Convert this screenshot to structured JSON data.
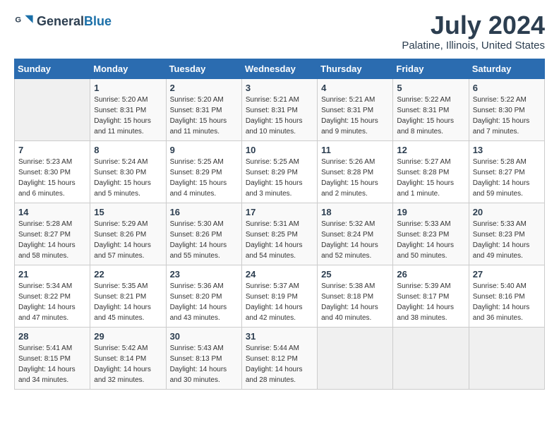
{
  "header": {
    "logo_general": "General",
    "logo_blue": "Blue",
    "title": "July 2024",
    "subtitle": "Palatine, Illinois, United States"
  },
  "calendar": {
    "days_of_week": [
      "Sunday",
      "Monday",
      "Tuesday",
      "Wednesday",
      "Thursday",
      "Friday",
      "Saturday"
    ],
    "weeks": [
      [
        {
          "day": "",
          "info": ""
        },
        {
          "day": "1",
          "info": "Sunrise: 5:20 AM\nSunset: 8:31 PM\nDaylight: 15 hours\nand 11 minutes."
        },
        {
          "day": "2",
          "info": "Sunrise: 5:20 AM\nSunset: 8:31 PM\nDaylight: 15 hours\nand 11 minutes."
        },
        {
          "day": "3",
          "info": "Sunrise: 5:21 AM\nSunset: 8:31 PM\nDaylight: 15 hours\nand 10 minutes."
        },
        {
          "day": "4",
          "info": "Sunrise: 5:21 AM\nSunset: 8:31 PM\nDaylight: 15 hours\nand 9 minutes."
        },
        {
          "day": "5",
          "info": "Sunrise: 5:22 AM\nSunset: 8:31 PM\nDaylight: 15 hours\nand 8 minutes."
        },
        {
          "day": "6",
          "info": "Sunrise: 5:22 AM\nSunset: 8:30 PM\nDaylight: 15 hours\nand 7 minutes."
        }
      ],
      [
        {
          "day": "7",
          "info": "Sunrise: 5:23 AM\nSunset: 8:30 PM\nDaylight: 15 hours\nand 6 minutes."
        },
        {
          "day": "8",
          "info": "Sunrise: 5:24 AM\nSunset: 8:30 PM\nDaylight: 15 hours\nand 5 minutes."
        },
        {
          "day": "9",
          "info": "Sunrise: 5:25 AM\nSunset: 8:29 PM\nDaylight: 15 hours\nand 4 minutes."
        },
        {
          "day": "10",
          "info": "Sunrise: 5:25 AM\nSunset: 8:29 PM\nDaylight: 15 hours\nand 3 minutes."
        },
        {
          "day": "11",
          "info": "Sunrise: 5:26 AM\nSunset: 8:28 PM\nDaylight: 15 hours\nand 2 minutes."
        },
        {
          "day": "12",
          "info": "Sunrise: 5:27 AM\nSunset: 8:28 PM\nDaylight: 15 hours\nand 1 minute."
        },
        {
          "day": "13",
          "info": "Sunrise: 5:28 AM\nSunset: 8:27 PM\nDaylight: 14 hours\nand 59 minutes."
        }
      ],
      [
        {
          "day": "14",
          "info": "Sunrise: 5:28 AM\nSunset: 8:27 PM\nDaylight: 14 hours\nand 58 minutes."
        },
        {
          "day": "15",
          "info": "Sunrise: 5:29 AM\nSunset: 8:26 PM\nDaylight: 14 hours\nand 57 minutes."
        },
        {
          "day": "16",
          "info": "Sunrise: 5:30 AM\nSunset: 8:26 PM\nDaylight: 14 hours\nand 55 minutes."
        },
        {
          "day": "17",
          "info": "Sunrise: 5:31 AM\nSunset: 8:25 PM\nDaylight: 14 hours\nand 54 minutes."
        },
        {
          "day": "18",
          "info": "Sunrise: 5:32 AM\nSunset: 8:24 PM\nDaylight: 14 hours\nand 52 minutes."
        },
        {
          "day": "19",
          "info": "Sunrise: 5:33 AM\nSunset: 8:23 PM\nDaylight: 14 hours\nand 50 minutes."
        },
        {
          "day": "20",
          "info": "Sunrise: 5:33 AM\nSunset: 8:23 PM\nDaylight: 14 hours\nand 49 minutes."
        }
      ],
      [
        {
          "day": "21",
          "info": "Sunrise: 5:34 AM\nSunset: 8:22 PM\nDaylight: 14 hours\nand 47 minutes."
        },
        {
          "day": "22",
          "info": "Sunrise: 5:35 AM\nSunset: 8:21 PM\nDaylight: 14 hours\nand 45 minutes."
        },
        {
          "day": "23",
          "info": "Sunrise: 5:36 AM\nSunset: 8:20 PM\nDaylight: 14 hours\nand 43 minutes."
        },
        {
          "day": "24",
          "info": "Sunrise: 5:37 AM\nSunset: 8:19 PM\nDaylight: 14 hours\nand 42 minutes."
        },
        {
          "day": "25",
          "info": "Sunrise: 5:38 AM\nSunset: 8:18 PM\nDaylight: 14 hours\nand 40 minutes."
        },
        {
          "day": "26",
          "info": "Sunrise: 5:39 AM\nSunset: 8:17 PM\nDaylight: 14 hours\nand 38 minutes."
        },
        {
          "day": "27",
          "info": "Sunrise: 5:40 AM\nSunset: 8:16 PM\nDaylight: 14 hours\nand 36 minutes."
        }
      ],
      [
        {
          "day": "28",
          "info": "Sunrise: 5:41 AM\nSunset: 8:15 PM\nDaylight: 14 hours\nand 34 minutes."
        },
        {
          "day": "29",
          "info": "Sunrise: 5:42 AM\nSunset: 8:14 PM\nDaylight: 14 hours\nand 32 minutes."
        },
        {
          "day": "30",
          "info": "Sunrise: 5:43 AM\nSunset: 8:13 PM\nDaylight: 14 hours\nand 30 minutes."
        },
        {
          "day": "31",
          "info": "Sunrise: 5:44 AM\nSunset: 8:12 PM\nDaylight: 14 hours\nand 28 minutes."
        },
        {
          "day": "",
          "info": ""
        },
        {
          "day": "",
          "info": ""
        },
        {
          "day": "",
          "info": ""
        }
      ]
    ]
  }
}
